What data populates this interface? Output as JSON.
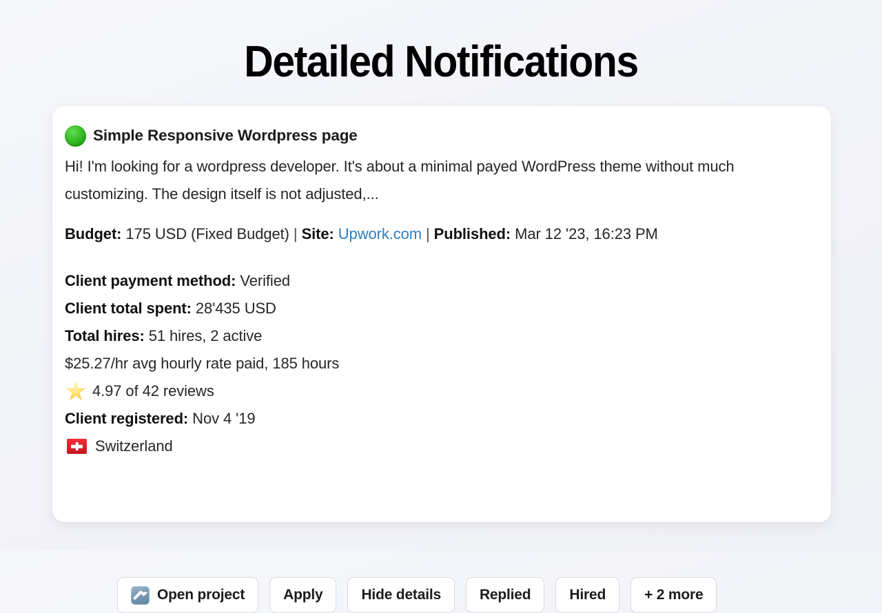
{
  "page": {
    "title": "Detailed Notifications",
    "background_color": "#f3f4f9"
  },
  "notification": {
    "status_icon": "green-circle-icon",
    "status_color": "#2fb624",
    "job_title": "Simple Responsive Wordpress page",
    "description": "Hi! I'm looking for a wordpress developer. It's about a minimal payed WordPress theme without much customizing. The design itself is not adjusted,...",
    "meta": {
      "budget_label": "Budget:",
      "budget_value": "175 USD (Fixed Budget)",
      "separator": "|",
      "site_label": "Site:",
      "site_value": "Upwork.com",
      "site_link_color": "#2a7fc4",
      "published_label": "Published:",
      "published_value": "Mar 12 '23, 16:23 PM"
    },
    "client_details": [
      {
        "label": "Client payment method:",
        "value": "Verified",
        "icon": null
      },
      {
        "label": "Client total spent:",
        "value": "28'435 USD",
        "icon": null
      },
      {
        "label": "Total hires:",
        "value": "51 hires, 2 active",
        "icon": null
      },
      {
        "label": "",
        "value": "$25.27/hr avg hourly rate paid, 185 hours",
        "icon": null
      },
      {
        "label": "",
        "value": "4.97 of 42 reviews",
        "icon": "star-icon"
      },
      {
        "label": "Client registered:",
        "value": "Nov 4 '19",
        "icon": null
      },
      {
        "label": "",
        "value": "Switzerland",
        "icon": "swiss-flag-icon"
      }
    ],
    "actions": [
      {
        "label": "Open project",
        "icon": "external-link-icon"
      },
      {
        "label": "Apply",
        "icon": null
      },
      {
        "label": "Hide details",
        "icon": null
      },
      {
        "label": "Replied",
        "icon": null
      },
      {
        "label": "Hired",
        "icon": null
      },
      {
        "label": "+ 2 more",
        "icon": null
      }
    ]
  }
}
